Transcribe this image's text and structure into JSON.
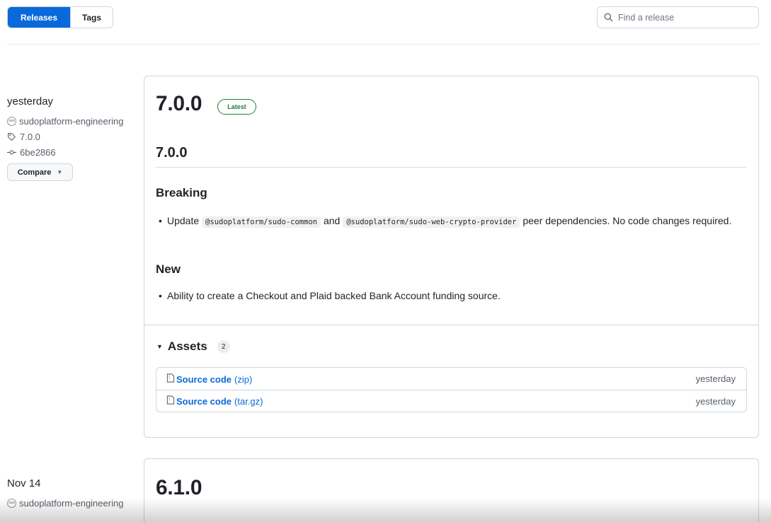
{
  "nav": {
    "releases_tab": "Releases",
    "tags_tab": "Tags"
  },
  "search": {
    "placeholder": "Find a release",
    "value": ""
  },
  "releases": [
    {
      "date": "yesterday",
      "author": "sudoplatform-engineering",
      "tag": "7.0.0",
      "commit": "6be2866",
      "compare_label": "Compare",
      "title": "7.0.0",
      "badge": "Latest",
      "heading": "7.0.0",
      "breaking_heading": "Breaking",
      "breaking_item": {
        "text1": "Update",
        "code1": "@sudoplatform/sudo-common",
        "text2": "and",
        "code2": "@sudoplatform/sudo-web-crypto-provider",
        "text3": "peer dependencies. No code changes required."
      },
      "new_heading": "New",
      "new_item": "Ability to create a Checkout and Plaid backed Bank Account funding source.",
      "assets_label": "Assets",
      "assets_count": "2",
      "assets": [
        {
          "name": "Source code",
          "ext": "(zip)",
          "when": "yesterday"
        },
        {
          "name": "Source code",
          "ext": "(tar.gz)",
          "when": "yesterday"
        }
      ]
    },
    {
      "date": "Nov 14",
      "author": "sudoplatform-engineering",
      "title": "6.1.0"
    }
  ],
  "icons": {
    "search": "search-icon",
    "avatar": "avatar",
    "tag": "tag-icon",
    "commit": "commit-icon",
    "zip": "file-zip-icon"
  },
  "colors": {
    "accent": "#0969da",
    "latest": "#1a7f37",
    "border": "#d0d7de"
  }
}
